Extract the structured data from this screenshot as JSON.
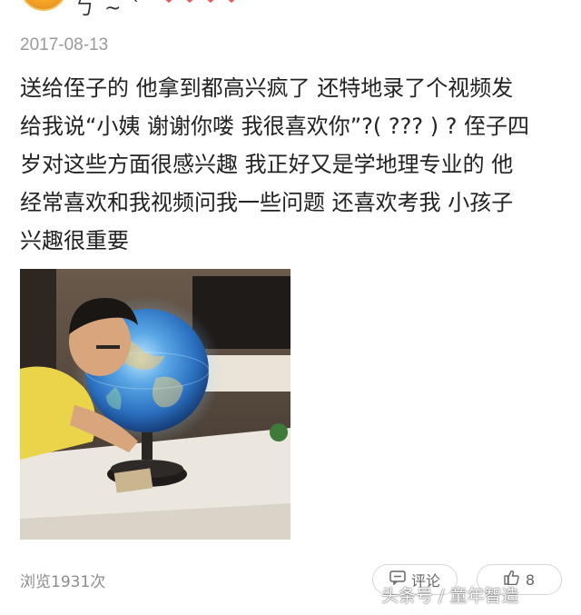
{
  "header": {
    "username_fragment": "ㄅ ~ ˋ",
    "hearts": [
      "❤",
      "❤",
      "❤",
      "❤"
    ]
  },
  "post": {
    "date": "2017-08-13",
    "lines": [
      "送给侄子的 他拿到都高兴疯了 还特地录了个视频发",
      "给我说“小姨 谢谢你喽 我很喜欢你”?( ??? ) ? 侄子四",
      "岁对这些方面很感兴趣 我正好又是学地理专业的 他",
      "经常喜欢和我视频问我一些问题 还喜欢考我 小孩子",
      "兴趣很重要"
    ]
  },
  "footer": {
    "views": "浏览1931次",
    "comment_label": "评论",
    "like_count": "8",
    "comment_icon": "comment-icon",
    "like_icon": "thumbs-up-icon"
  },
  "watermark": "头条号 / 童年智造",
  "colors": {
    "date": "#9a9a9a",
    "body_text": "#222222",
    "views": "#8c8c8c",
    "heart": "#e8555a"
  }
}
